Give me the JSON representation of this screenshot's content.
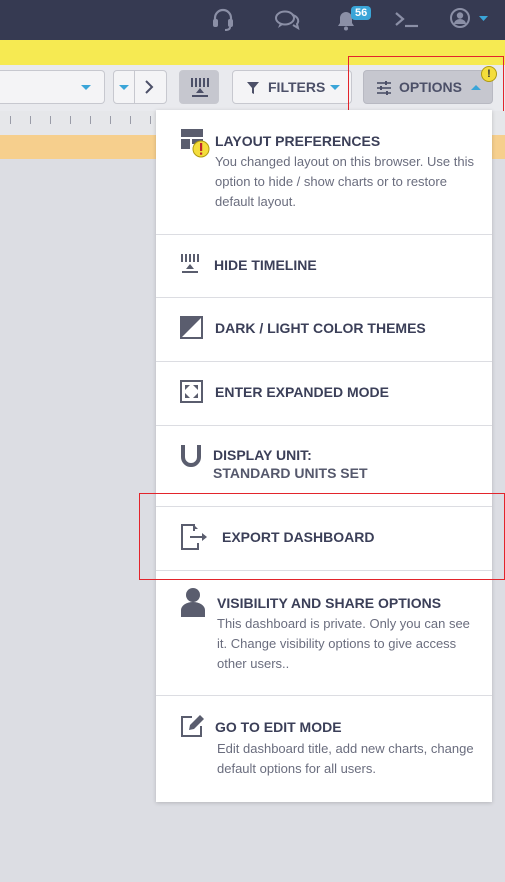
{
  "topbar": {
    "icons": [
      "headset-icon",
      "chat-icon",
      "bell-icon",
      "terminal-icon",
      "user-icon"
    ],
    "notification_count": "56"
  },
  "toolbar": {
    "filters_label": "FILTERS",
    "options_label": "OPTIONS"
  },
  "menu": {
    "layout_preferences": {
      "title": "LAYOUT PREFERENCES",
      "description": "You changed layout on this browser. Use this option to hide / show charts or to restore default layout."
    },
    "hide_timeline": {
      "title": "HIDE TIMELINE"
    },
    "color_themes": {
      "title": "DARK / LIGHT COLOR THEMES"
    },
    "expanded_mode": {
      "title": "ENTER EXPANDED MODE"
    },
    "display_unit": {
      "title": "DISPLAY UNIT:",
      "subtitle": "STANDARD UNITS SET"
    },
    "export_dashboard": {
      "title": "EXPORT DASHBOARD"
    },
    "visibility": {
      "title": "VISIBILITY AND SHARE OPTIONS",
      "description": "This dashboard is private. Only you can see it. Change visibility options to give access other users.."
    },
    "edit_mode": {
      "title": "GO TO EDIT MODE",
      "description": "Edit dashboard title, add new charts, change default options for all users."
    }
  },
  "colors": {
    "topbar": "#363a52",
    "notification_yellow": "#f6ea52",
    "warning_orange": "#f6cf8d",
    "highlight_red": "#e3242b",
    "accent_blue": "#3aa5d8"
  }
}
